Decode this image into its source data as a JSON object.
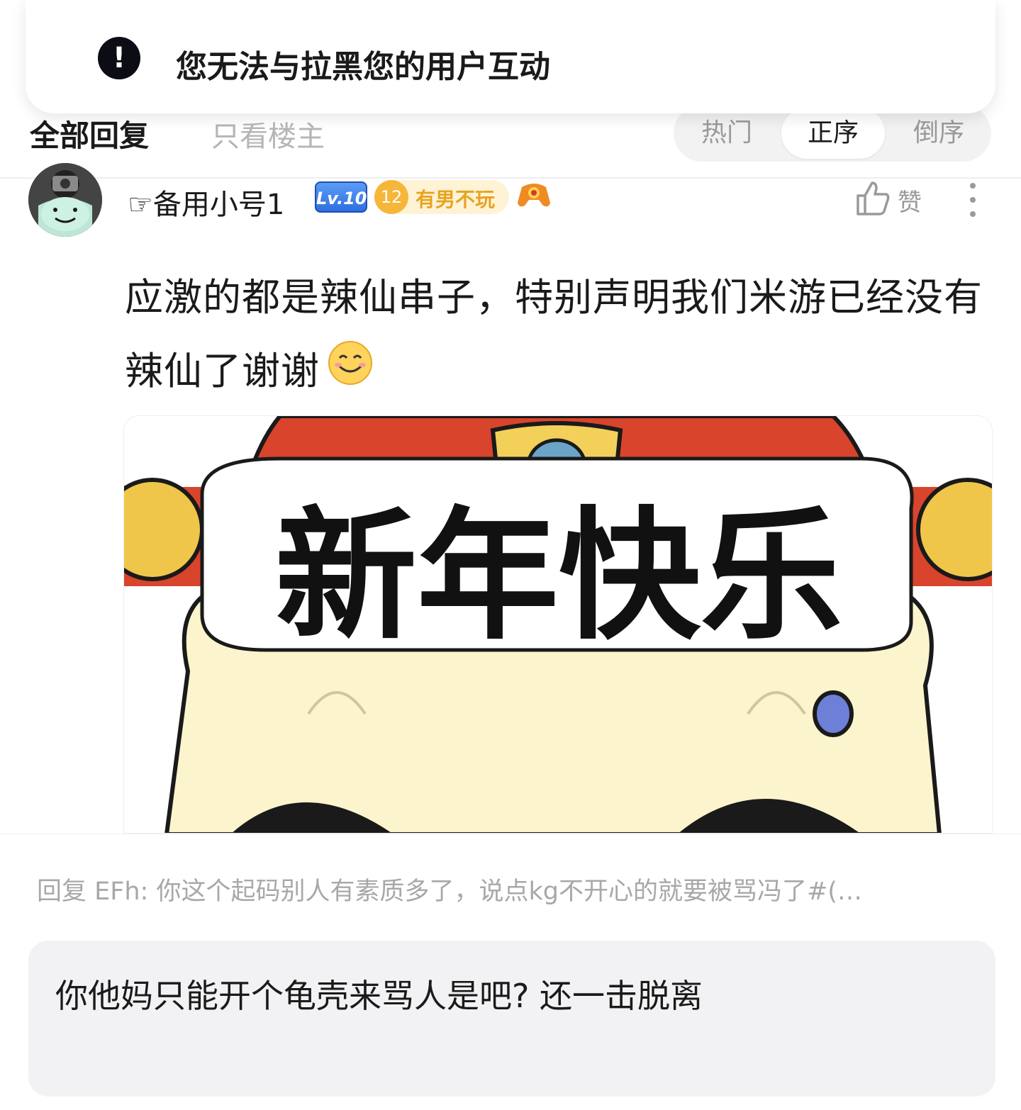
{
  "toast": {
    "icon": "exclamation-icon",
    "icon_glyph": "!",
    "message": "您无法与拉黑您的用户互动"
  },
  "tabs": {
    "all": "全部回复",
    "op_only": "只看楼主",
    "sort": {
      "hot": "热门",
      "asc": "正序",
      "desc": "倒序",
      "selected": "正序"
    }
  },
  "comment": {
    "username": "☞备用小号1",
    "level": "Lv.10",
    "medal_level": "12",
    "medal_name": "有男不玩",
    "like_label": "赞",
    "text": "应激的都是辣仙串子，特别声明我们米游已经没有辣仙了谢谢",
    "image": {
      "caption_text": "新年快乐"
    }
  },
  "reply": {
    "hint": "回复 EFh: 你这个起码别人有素质多了，说点kg不开心的就要被骂冯了#(…",
    "input_value": "你他妈只能开个龟壳来骂人是吧? 还一击脱离"
  },
  "colors": {
    "accent": "#2f6fe0",
    "medal": "#f6b63a",
    "muted": "#9a9a9a"
  }
}
